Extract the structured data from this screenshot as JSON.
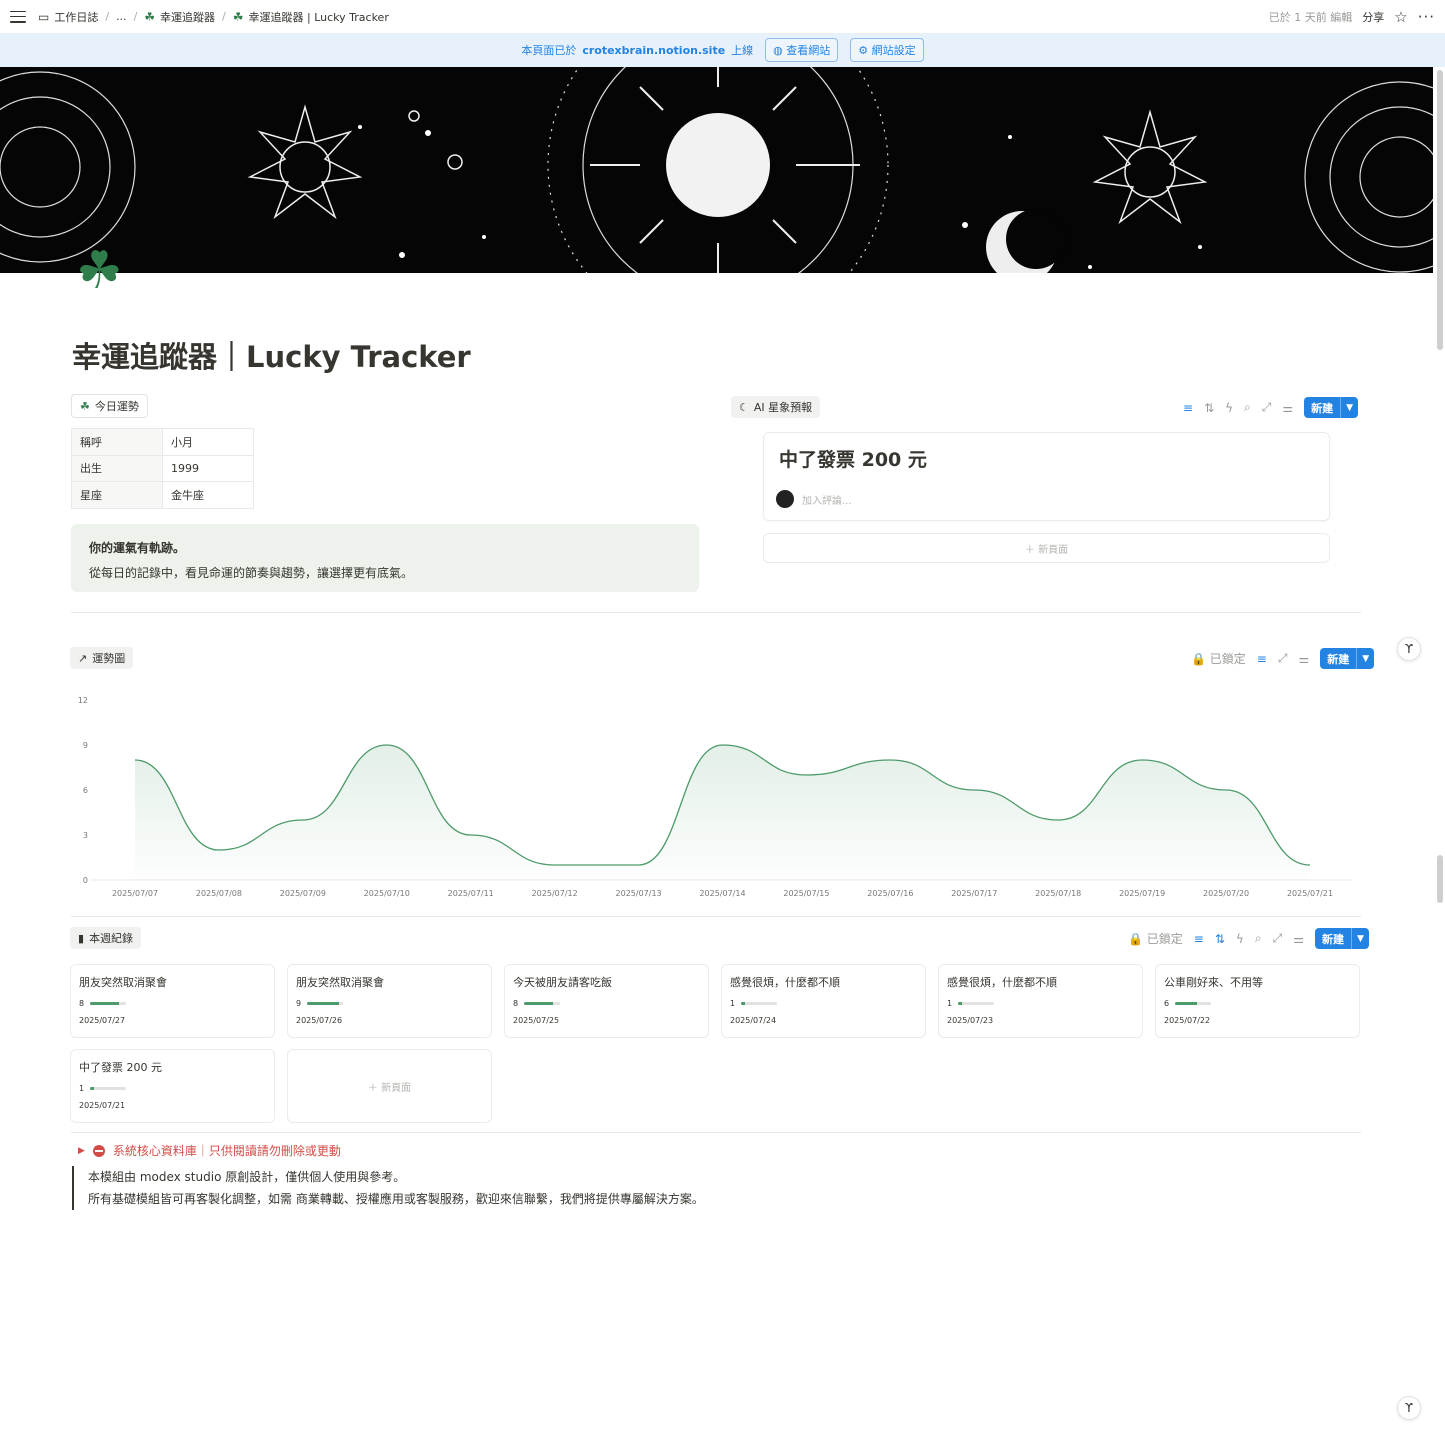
{
  "breadcrumb": {
    "items": [
      "工作日誌",
      "...",
      "幸運追蹤器",
      "幸運追蹤器 | Lucky Tracker"
    ]
  },
  "topbar": {
    "edited": "已於 1 天前 編輯",
    "share": "分享"
  },
  "banner": {
    "prefix": "本頁面已於",
    "site": "crotexbrain.notion.site",
    "suffix": "上線",
    "view_site": "查看網站",
    "site_settings": "網站設定"
  },
  "page": {
    "title": "幸運追蹤器｜Lucky Tracker"
  },
  "today_section": {
    "label": "今日運勢",
    "rows": [
      {
        "key": "稱呼",
        "value": "小月"
      },
      {
        "key": "出生",
        "value": "1999"
      },
      {
        "key": "星座",
        "value": "金牛座"
      }
    ]
  },
  "callout": {
    "heading": "你的運氣有軌跡。",
    "body": "從每日的記錄中，看見命運的節奏與趨勢，讓選擇更有底氣。"
  },
  "ai_section": {
    "label": "AI 星象預報",
    "new_label": "新建",
    "card_title": "中了發票 200 元",
    "comment_placeholder": "加入評論...",
    "new_page": "新頁面"
  },
  "trend_section": {
    "label": "運勢圖",
    "locked": "已鎖定",
    "new_label": "新建"
  },
  "chart_data": {
    "type": "area",
    "x": [
      "2025/07/07",
      "2025/07/08",
      "2025/07/09",
      "2025/07/10",
      "2025/07/11",
      "2025/07/12",
      "2025/07/13",
      "2025/07/14",
      "2025/07/15",
      "2025/07/16",
      "2025/07/17",
      "2025/07/18",
      "2025/07/19",
      "2025/07/20",
      "2025/07/21"
    ],
    "values": [
      8,
      2,
      4,
      9,
      3,
      1,
      1,
      9,
      7,
      8,
      6,
      4,
      8,
      6,
      1
    ],
    "yticks": [
      "0",
      "3",
      "6",
      "9",
      "12"
    ],
    "ylim": [
      0,
      12
    ],
    "color": "#4d9a6a",
    "grid": false
  },
  "week_section": {
    "label": "本週紀錄",
    "locked": "已鎖定",
    "new_label": "新建",
    "new_page": "新頁面",
    "cards": [
      {
        "title": "朋友突然取消聚會",
        "score": "8",
        "level": 0.8,
        "date": "2025/07/27"
      },
      {
        "title": "朋友突然取消聚會",
        "score": "9",
        "level": 0.9,
        "date": "2025/07/26"
      },
      {
        "title": "今天被朋友請客吃飯",
        "score": "8",
        "level": 0.8,
        "date": "2025/07/25"
      },
      {
        "title": "感覺很煩，什麼都不順",
        "score": "1",
        "level": 0.1,
        "date": "2025/07/24"
      },
      {
        "title": "感覺很煩，什麼都不順",
        "score": "1",
        "level": 0.1,
        "date": "2025/07/23"
      },
      {
        "title": "公車剛好來、不用等",
        "score": "6",
        "level": 0.6,
        "date": "2025/07/22"
      },
      {
        "title": "中了發票 200 元",
        "score": "1",
        "level": 0.1,
        "date": "2025/07/21"
      }
    ]
  },
  "core_toggle": {
    "label": "系統核心資料庫｜只供閱讀請勿刪除或更動"
  },
  "footer_quote": {
    "line1": "本模組由 modex studio 原創設計，僅供個人使用與參考。",
    "line2": "所有基礎模組皆可再客製化調整，如需 商業轉載、授權應用或客製服務，歡迎來信聯繫，我們將提供專屬解決方案。"
  }
}
